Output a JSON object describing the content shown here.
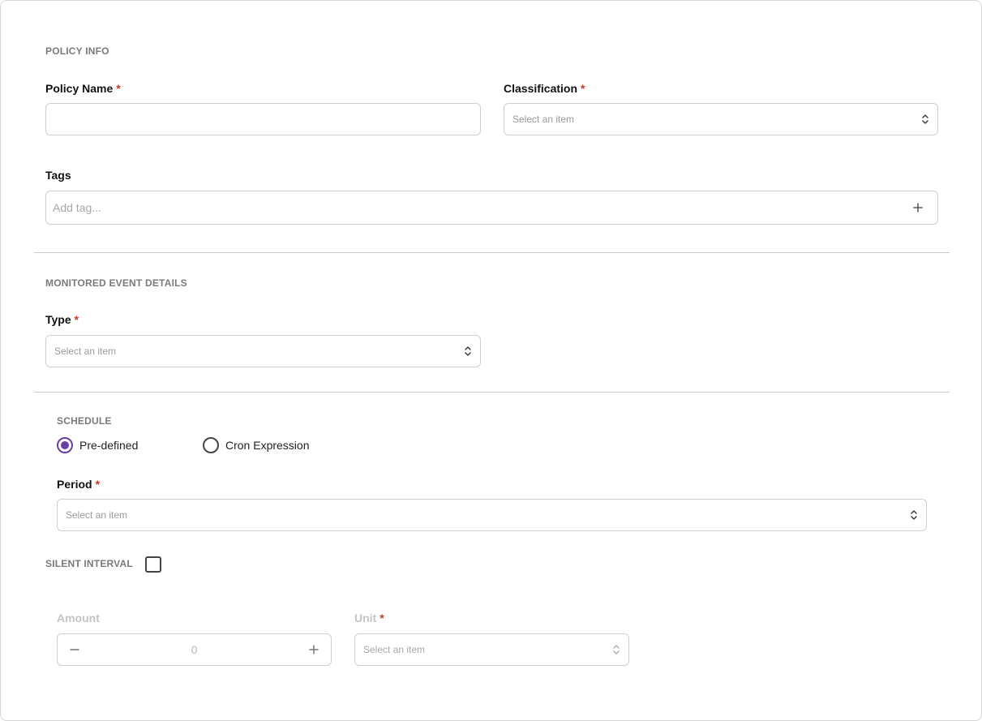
{
  "policy_info": {
    "section_title": "POLICY INFO",
    "policy_name": {
      "label": "Policy Name",
      "required_mark": "*",
      "value": ""
    },
    "classification": {
      "label": "Classification",
      "required_mark": "*",
      "placeholder": "Select an item"
    },
    "tags": {
      "label": "Tags",
      "placeholder": "Add tag..."
    }
  },
  "monitored_event": {
    "section_title": "MONITORED EVENT DETAILS",
    "type": {
      "label": "Type",
      "required_mark": "*",
      "placeholder": "Select an item"
    }
  },
  "schedule": {
    "section_title": "SCHEDULE",
    "options": [
      {
        "label": "Pre-defined",
        "selected": true
      },
      {
        "label": "Cron Expression",
        "selected": false
      }
    ],
    "period": {
      "label": "Period",
      "required_mark": "*",
      "placeholder": "Select an item"
    }
  },
  "silent_interval": {
    "section_title": "SILENT INTERVAL",
    "checked": false,
    "amount": {
      "label": "Amount",
      "value": "0"
    },
    "unit": {
      "label": "Unit",
      "required_mark": "*",
      "placeholder": "Select an item"
    }
  },
  "colors": {
    "accent": "#6b3fa0",
    "required": "#c0392b",
    "border": "#cfcfcf"
  }
}
